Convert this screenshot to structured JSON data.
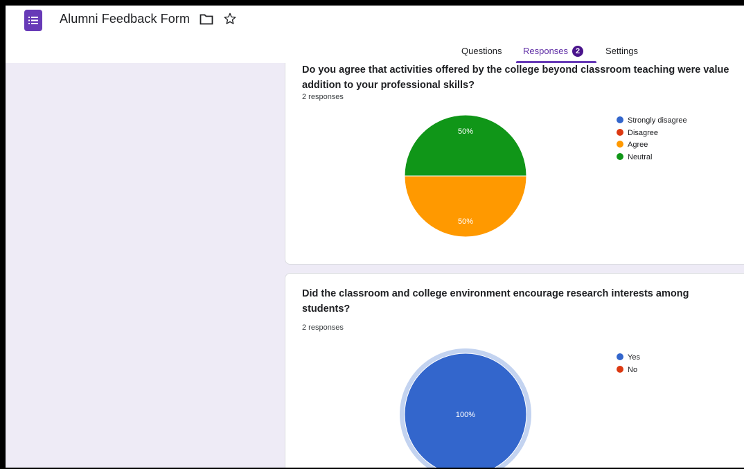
{
  "app": {
    "title": "Alumni Feedback Form",
    "icons": {
      "app": "forms-list-icon",
      "folder": "folder-icon",
      "star": "star-outline-icon"
    }
  },
  "tabs": [
    {
      "label": "Questions",
      "active": false
    },
    {
      "label": "Responses",
      "active": true,
      "badge": "2"
    },
    {
      "label": "Settings",
      "active": false
    }
  ],
  "colors": {
    "accent": "#673ab7",
    "badge": "#4a148c",
    "background": "#eeebf6",
    "blue": "#3366cc",
    "red": "#dc3912",
    "orange": "#ff9900",
    "green": "#109618"
  },
  "questions": [
    {
      "title": "Do you agree that activities offered by the college beyond classroom teaching were value addition to your professional skills?",
      "responses": "2 responses",
      "chart_data": {
        "type": "pie",
        "categories": [
          "Strongly disagree",
          "Disagree",
          "Agree",
          "Neutral"
        ],
        "values": [
          0,
          0,
          50,
          50
        ],
        "unit": "%",
        "colors": [
          "#3366cc",
          "#dc3912",
          "#ff9900",
          "#109618"
        ],
        "slice_labels": [
          "50%",
          "50%"
        ],
        "legend": "right"
      }
    },
    {
      "title": "Did the classroom and college environment encourage research interests among students?",
      "responses": "2 responses",
      "chart_data": {
        "type": "pie",
        "categories": [
          "Yes",
          "No"
        ],
        "values": [
          100,
          0
        ],
        "unit": "%",
        "colors": [
          "#3366cc",
          "#dc3912"
        ],
        "slice_labels": [
          "100%"
        ],
        "legend": "right"
      }
    }
  ]
}
